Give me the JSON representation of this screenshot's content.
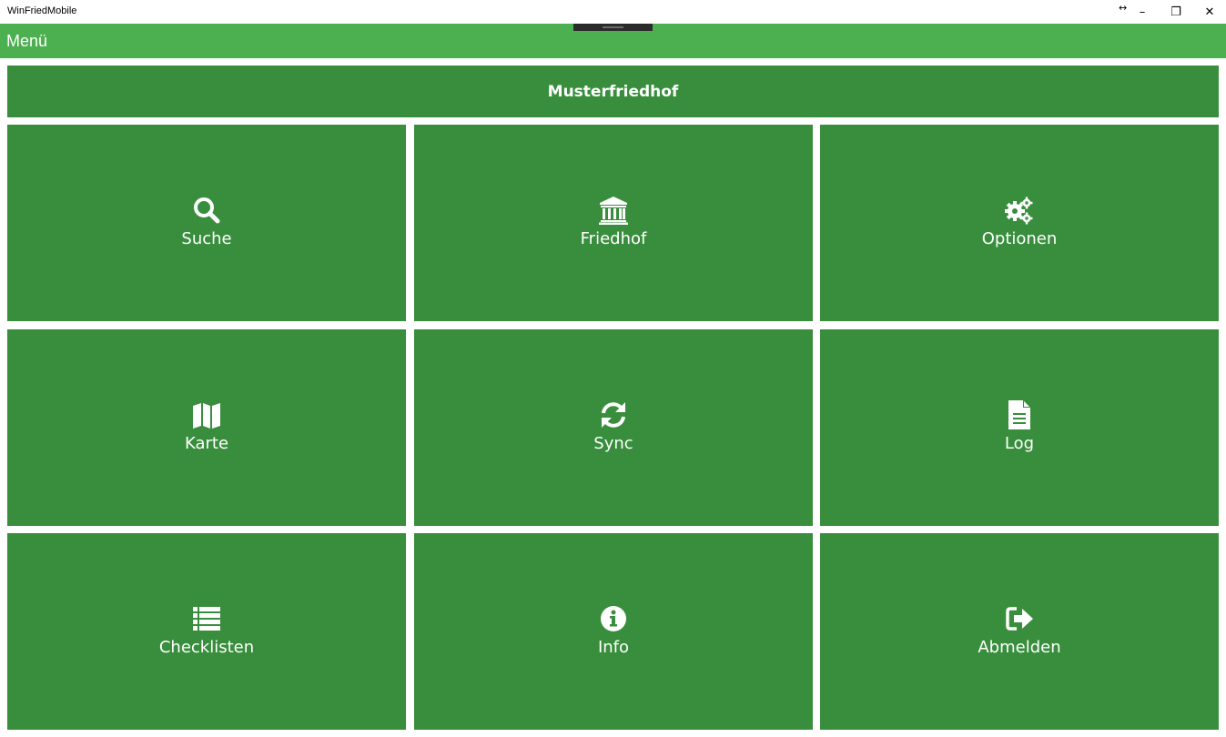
{
  "window": {
    "title": "WinFriedMobile",
    "controls": {
      "minimize": "–",
      "maximize": "❐",
      "close": "✕",
      "resize": "↔"
    }
  },
  "menubar": {
    "title": "Menü"
  },
  "header": {
    "title": "Musterfriedhof"
  },
  "tiles": [
    {
      "label": "Suche",
      "icon": "search-icon"
    },
    {
      "label": "Friedhof",
      "icon": "institution-icon"
    },
    {
      "label": "Optionen",
      "icon": "gears-icon"
    },
    {
      "label": "Karte",
      "icon": "map-icon"
    },
    {
      "label": "Sync",
      "icon": "refresh-icon"
    },
    {
      "label": "Log",
      "icon": "file-text-icon"
    },
    {
      "label": "Checklisten",
      "icon": "list-icon"
    },
    {
      "label": "Info",
      "icon": "info-circle-icon"
    },
    {
      "label": "Abmelden",
      "icon": "sign-out-icon"
    }
  ],
  "colors": {
    "menubar": "#4caf50",
    "tile": "#388e3c",
    "text": "#ffffff"
  }
}
